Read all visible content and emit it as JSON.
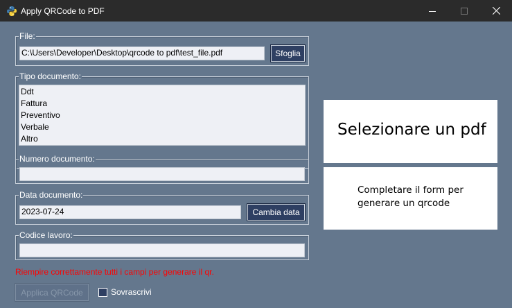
{
  "window": {
    "title": "Apply QRCode to PDF",
    "icon": "python-icon"
  },
  "file": {
    "label": "File:",
    "value": "C:\\Users\\Developer\\Desktop\\qrcode to pdf\\test_file.pdf",
    "browse_label": "Sfoglia"
  },
  "doc_type": {
    "label": "Tipo documento:",
    "items": [
      "Ddt",
      "Fattura",
      "Preventivo",
      "Verbale",
      "Altro"
    ]
  },
  "doc_number": {
    "label": "Numero documento:",
    "value": ""
  },
  "doc_date": {
    "label": "Data documento:",
    "value": "2023-07-24",
    "change_label": "Cambia data"
  },
  "job_code": {
    "label": "Codice lavoro:",
    "value": ""
  },
  "error_message": "Riempire correttamente tutti i campi per generare il qr.",
  "apply_button": {
    "label": "Applica QRCode",
    "enabled": false
  },
  "overwrite": {
    "label": "Sovrascrivi",
    "checked": false
  },
  "preview": {
    "title": "Selezionare un pdf",
    "message": "Completare il form per generare un qrcode"
  },
  "colors": {
    "background": "#64778d",
    "button": "#2e3f62",
    "error": "#ff0000",
    "titlebar": "#2b2b2b"
  }
}
